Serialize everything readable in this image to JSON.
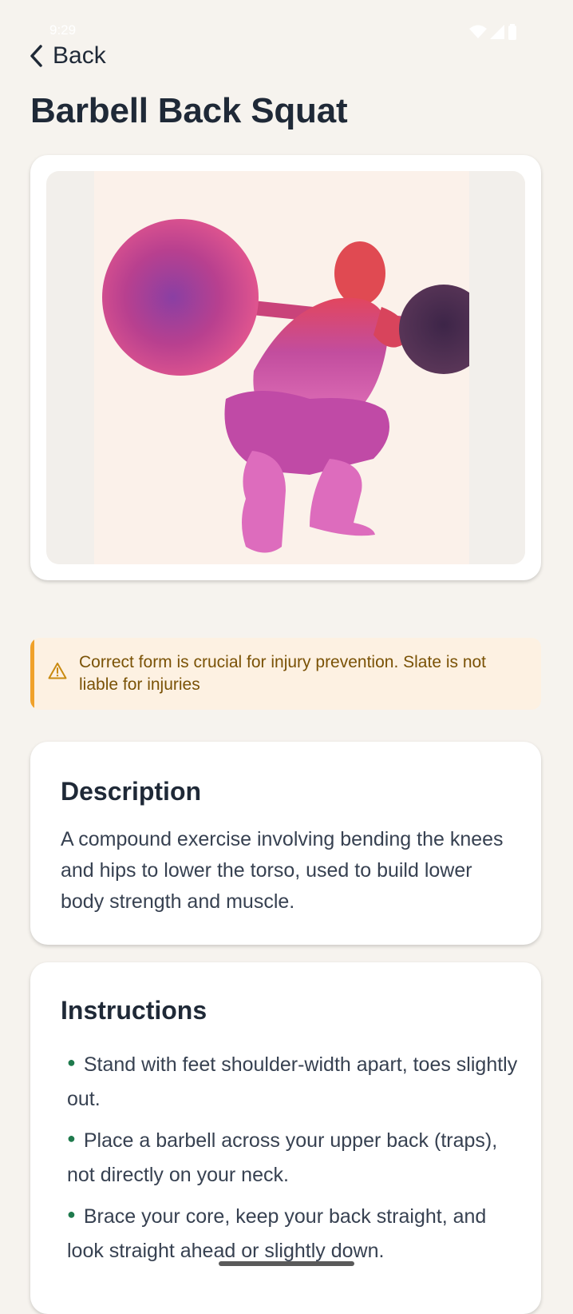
{
  "status_bar": {
    "time": "9:29"
  },
  "nav": {
    "back_label": "Back"
  },
  "exercise": {
    "title": "Barbell Back Squat",
    "image_alt": "Watercolor squat illustration"
  },
  "warning": {
    "text": "Correct form is crucial for injury prevention. Slate is not liable for injuries"
  },
  "description": {
    "heading": "Description",
    "body": "A compound exercise involving bending the knees and hips to lower the torso, used to build lower body strength and muscle."
  },
  "instructions": {
    "heading": "Instructions",
    "steps": [
      "Stand with feet shoulder-width apart, toes slightly out.",
      "Place a barbell across your upper back (traps), not directly on your neck.",
      "Brace your core, keep your back straight, and look straight ahead or slightly down."
    ]
  },
  "colors": {
    "background": "#f6f3ee",
    "warning_accent": "#f0a12a",
    "warning_text": "#7a5206",
    "bullet": "#1f7a4d"
  }
}
